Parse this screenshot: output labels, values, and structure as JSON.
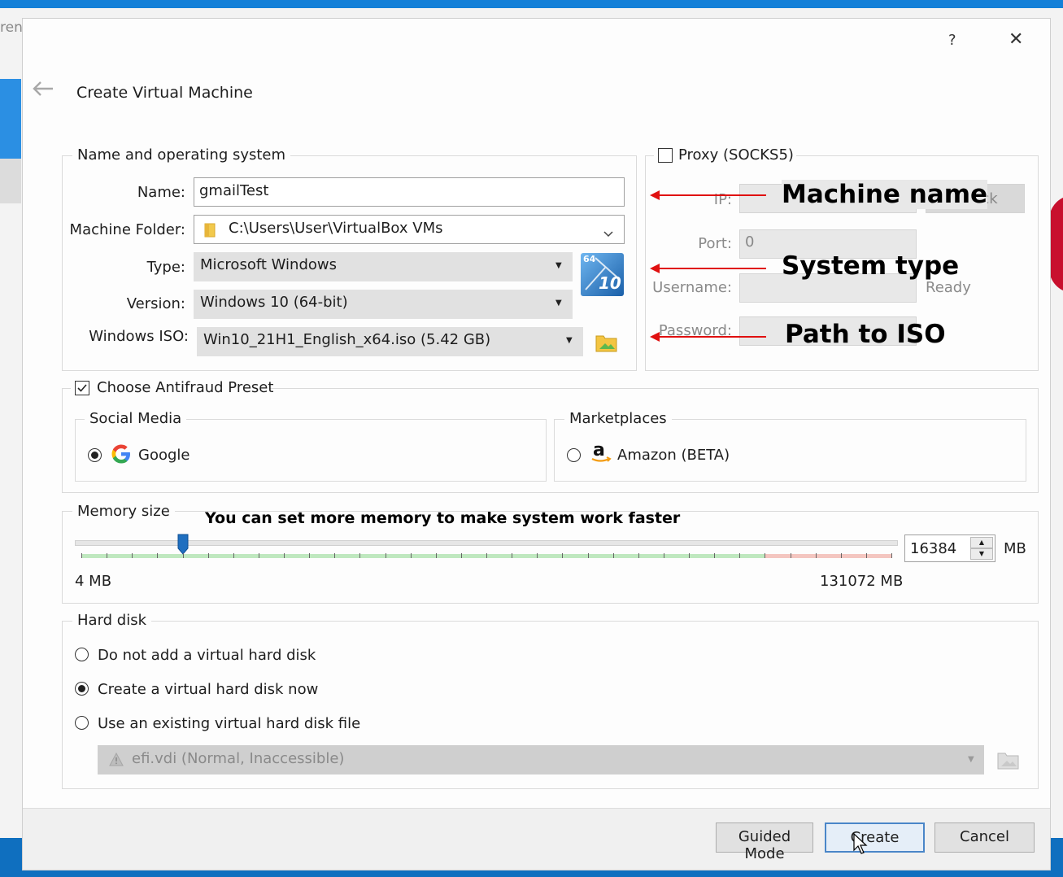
{
  "background": {
    "partial_text": "ren"
  },
  "dialog": {
    "title": "Create Virtual Machine",
    "help": "?",
    "close": "✕",
    "back": "🡐"
  },
  "name_os": {
    "legend": "Name and operating system",
    "name_label": "Name:",
    "name_value": "gmailTest",
    "folder_label": "Machine Folder:",
    "folder_value": "C:\\Users\\User\\VirtualBox VMs",
    "type_label": "Type:",
    "type_value": "Microsoft Windows",
    "version_label": "Version:",
    "version_value": "Windows 10 (64-bit)",
    "os_badge_top": "64",
    "os_badge_num": "10",
    "iso_label": "Windows ISO:",
    "iso_value": "Win10_21H1_English_x64.iso (5.42 GB)"
  },
  "proxy": {
    "checkbox_label": "Proxy (SOCKS5)",
    "checked": false,
    "ip_label": "IP:",
    "check_button": "Check",
    "port_label": "Port:",
    "port_value": "0",
    "username_label": "Username:",
    "status": "Ready",
    "password_label": "Password:"
  },
  "annotations": {
    "machine_name": "Machine name",
    "system_type": "System type",
    "path_to_iso": "Path to ISO",
    "memory_tip": "You can set more memory to make system work faster"
  },
  "antifraud": {
    "checkbox_label": "Choose Antifraud Preset",
    "checked": true,
    "social_legend": "Social Media",
    "google_label": "Google",
    "google_selected": true,
    "market_legend": "Marketplaces",
    "amazon_label": "Amazon (BETA)",
    "amazon_selected": false
  },
  "memory": {
    "legend": "Memory size",
    "value": "16384",
    "unit": "MB",
    "min_label": "4 MB",
    "max_label": "131072 MB",
    "slider_fraction": 0.125
  },
  "hard_disk": {
    "legend": "Hard disk",
    "options": [
      {
        "label": "Do not add a virtual hard disk",
        "selected": false
      },
      {
        "label": "Create a virtual hard disk now",
        "selected": true
      },
      {
        "label": "Use an existing virtual hard disk file",
        "selected": false
      }
    ],
    "existing_file": "efi.vdi (Normal, Inaccessible)"
  },
  "buttons": {
    "guided": "Guided Mode",
    "create": "Create",
    "cancel": "Cancel"
  },
  "colors": {
    "arrow": "#e01010",
    "primary_border": "#4a86c8",
    "slider_handle": "#1f6fc0"
  }
}
